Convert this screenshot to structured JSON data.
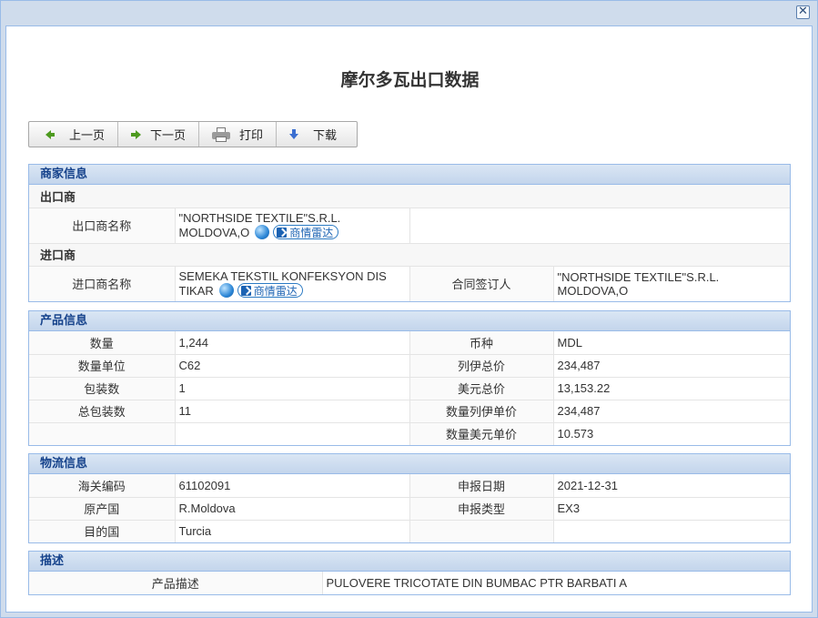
{
  "page_title": "摩尔多瓦出口数据",
  "close_label": "✕",
  "toolbar": {
    "prev": "上一页",
    "next": "下一页",
    "print": "打印",
    "download": "下载"
  },
  "merchant": {
    "header": "商家信息",
    "exporter_header": "出口商",
    "exporter_label": "出口商名称",
    "exporter_name_line1": "\"NORTHSIDE TEXTILE\"S.R.L.",
    "exporter_name_line2": "MOLDOVA,O",
    "radar_label": "商情雷达",
    "importer_header": "进口商",
    "importer_label": "进口商名称",
    "importer_name_line1": "SEMEKA TEKSTIL KONFEKSYON DIS",
    "importer_name_line2": "TIKAR",
    "contract_label": "合同签订人",
    "contract_line1": "\"NORTHSIDE TEXTILE\"S.R.L.",
    "contract_line2": "MOLDOVA,O"
  },
  "product": {
    "header": "产品信息",
    "rows": [
      {
        "l1": "数量",
        "v1": "1,244",
        "l2": "币种",
        "v2": "MDL"
      },
      {
        "l1": "数量单位",
        "v1": "C62",
        "l2": "列伊总价",
        "v2": "234,487"
      },
      {
        "l1": "包装数",
        "v1": "1",
        "l2": "美元总价",
        "v2": "13,153.22"
      },
      {
        "l1": "总包装数",
        "v1": "11",
        "l2": "数量列伊单价",
        "v2": "234,487"
      },
      {
        "l1": "",
        "v1": "",
        "l2": "数量美元单价",
        "v2": "10.573"
      }
    ]
  },
  "logistics": {
    "header": "物流信息",
    "rows": [
      {
        "l1": "海关编码",
        "v1": "61102091",
        "l2": "申报日期",
        "v2": "2021-12-31"
      },
      {
        "l1": "原产国",
        "v1": "R.Moldova",
        "l2": "申报类型",
        "v2": "EX3"
      },
      {
        "l1": "目的国",
        "v1": "Turcia",
        "l2": "",
        "v2": ""
      }
    ]
  },
  "description": {
    "header": "描述",
    "label": "产品描述",
    "value": "PULOVERE TRICOTATE DIN BUMBAC PTR BARBATI A"
  }
}
